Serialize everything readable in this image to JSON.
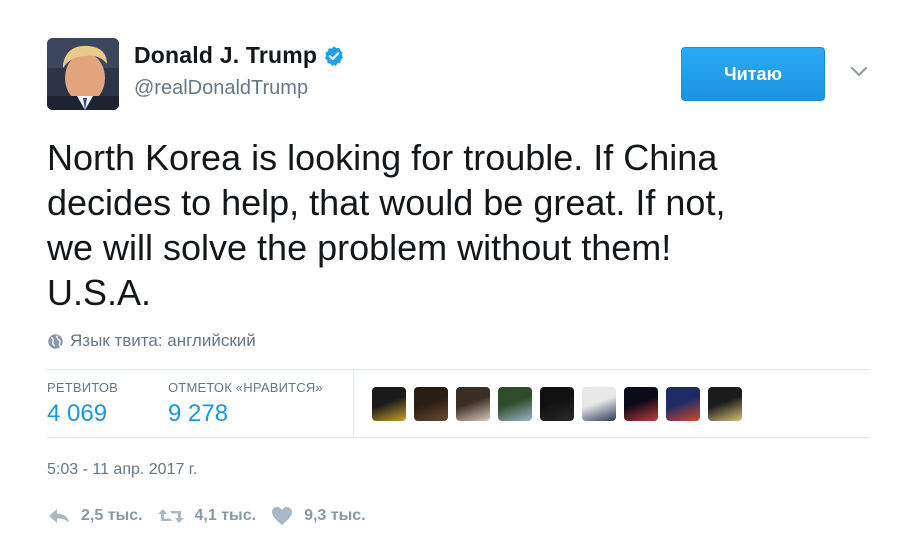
{
  "author": {
    "name": "Donald J. Trump",
    "handle": "@realDonaldTrump",
    "verified": true
  },
  "follow_button": {
    "label": "Читаю"
  },
  "tweet": {
    "lines": [
      "North Korea is looking for trouble. If China",
      "decides to help, that would be great. If not,",
      "we will solve the problem without them!",
      "U.S.A."
    ]
  },
  "language": {
    "text": "Язык твита: английский"
  },
  "stats": {
    "retweets_label": "РЕТВИТОВ",
    "retweets_value": "4 069",
    "likes_label": "ОТМЕТОК «НРАВИТСЯ»",
    "likes_value": "9 278"
  },
  "likers": [
    {
      "colors": [
        "#1a1a1a",
        "#c9a227"
      ]
    },
    {
      "colors": [
        "#2a1d14",
        "#6b4a33"
      ]
    },
    {
      "colors": [
        "#3a2e26",
        "#d9cbbd"
      ]
    },
    {
      "colors": [
        "#2e4b2a",
        "#9fb6c8"
      ]
    },
    {
      "colors": [
        "#111111",
        "#2b2b2b"
      ]
    },
    {
      "colors": [
        "#e8e8e8",
        "#2d3a55"
      ]
    },
    {
      "colors": [
        "#0b0b1a",
        "#c23c3c"
      ]
    },
    {
      "colors": [
        "#1d2a66",
        "#d14a2a"
      ]
    },
    {
      "colors": [
        "#1c1c1c",
        "#d8c07a"
      ]
    }
  ],
  "timestamp": "5:03 - 11 апр. 2017 г.",
  "actions": {
    "reply_count": "2,5 тыс.",
    "retweet_count": "4,1 тыс.",
    "like_count": "9,3 тыс."
  },
  "colors": {
    "accent": "#1da1f2",
    "link": "#1b95e0",
    "muted": "#657786",
    "icon_muted": "#aab8c2"
  }
}
